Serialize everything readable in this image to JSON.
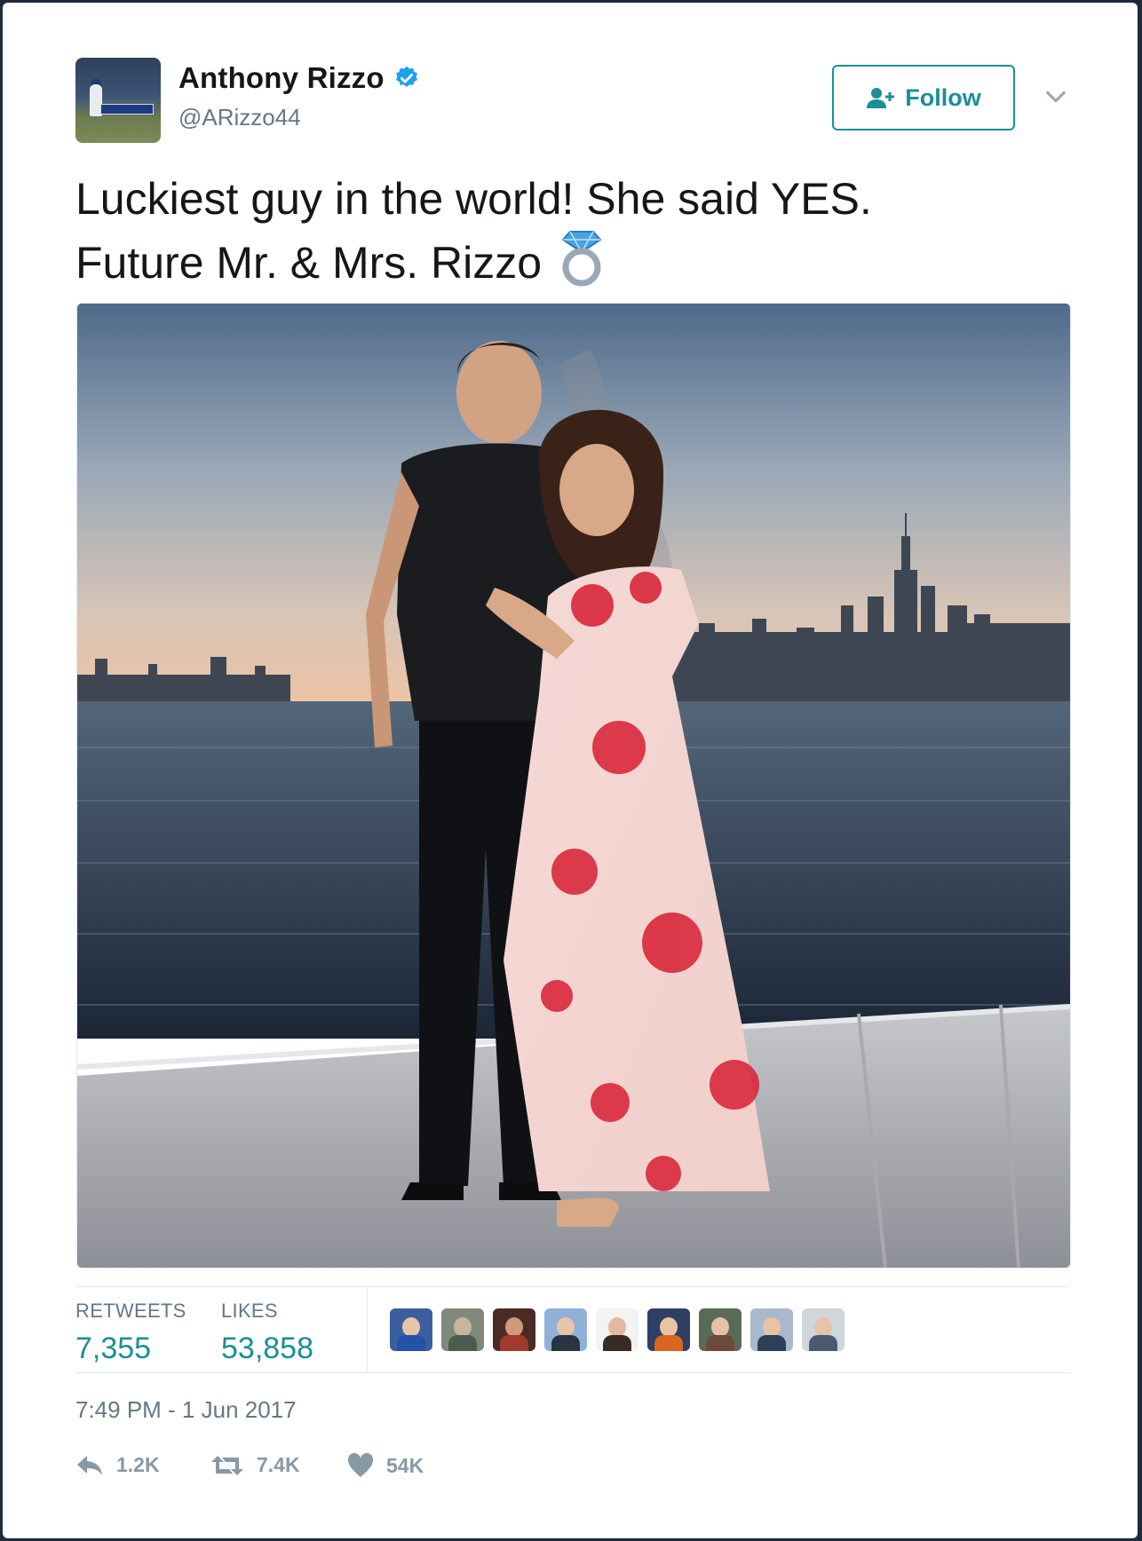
{
  "user": {
    "name": "Anthony Rizzo",
    "handle": "@ARizzo44",
    "verified": true
  },
  "follow_button": {
    "label": "Follow",
    "icon": "add-user-icon"
  },
  "menu_icon": "chevron-down-icon",
  "tweet": {
    "line1": "Luckiest guy in the world! She said YES.",
    "line2": "Future Mr. & Mrs. Rizzo",
    "emoji_icon": "ring-icon"
  },
  "stats": {
    "retweets_label": "RETWEETS",
    "retweets_value": "7,355",
    "likes_label": "LIKES",
    "likes_value": "53,858"
  },
  "likers_count": 9,
  "timestamp": "7:49 PM - 1 Jun 2017",
  "actions": {
    "reply_count": "1.2K",
    "retweet_count": "7.4K",
    "like_count": "54K"
  },
  "colors": {
    "accent": "#1b8f96",
    "verified": "#1da1f2",
    "muted": "#657786",
    "text": "#14171a"
  }
}
